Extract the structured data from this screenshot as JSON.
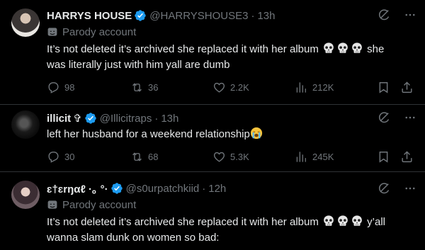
{
  "tweets": [
    {
      "name": "HARRYS HOUSE",
      "handle": "@HARRYSHOUSE3",
      "time": "13h",
      "parody": "Parody account",
      "text_before": "It’s not deleted it’s archived she replaced it with her album",
      "emoji": "skull-icon x3",
      "text_after": "she",
      "text_line2": "was literally just with him yall are dumb",
      "replies": "98",
      "reposts": "36",
      "likes": "2.2K",
      "views": "212K"
    },
    {
      "name": "illicit",
      "name_suffix": "✞",
      "handle": "@Illicitraps",
      "time": "13h",
      "text_before": "left her husband for a weekend relationship",
      "emoji": "loudly-crying-face-icon",
      "replies": "30",
      "reposts": "68",
      "likes": "5.3K",
      "views": "245K"
    },
    {
      "name": "ɛ†ɛrŋαℓ ·｡ °·",
      "handle": "@s0urpatchkiid",
      "time": "12h",
      "parody": "Parody account",
      "text_before": "It’s not deleted it’s archived she replaced it with her album",
      "emoji": "skull-icon x3",
      "text_after": "y’all",
      "text_line2": "wanna slam dunk on women so bad:"
    }
  ],
  "dot": "·",
  "colors": {
    "bg": "#000000",
    "text": "#e7e9ea",
    "muted": "#71767b",
    "verified": "#1d9bf0",
    "divider": "#2f3336"
  }
}
